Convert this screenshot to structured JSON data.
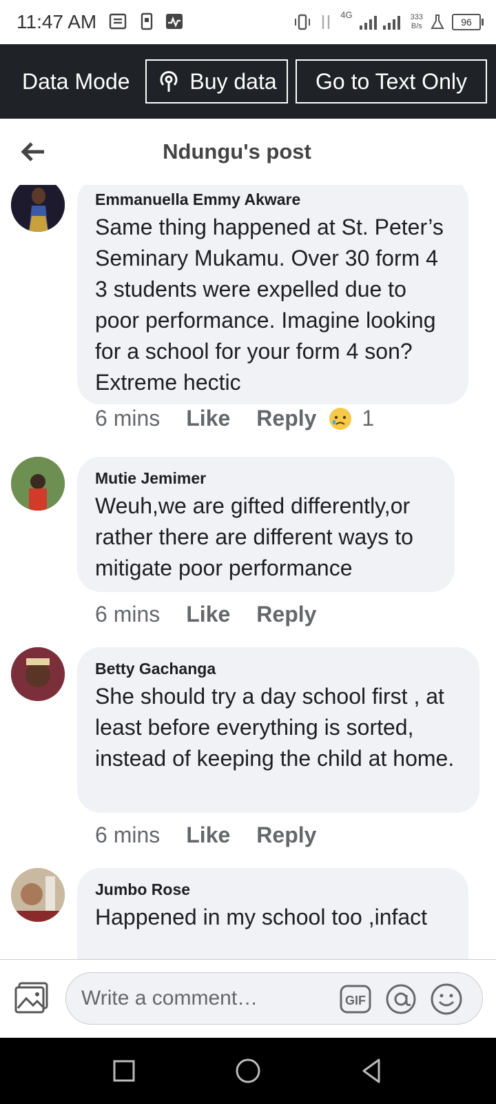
{
  "status_bar": {
    "time": "11:47 AM",
    "network": "4G",
    "speed": "333\nB/s",
    "battery": "96"
  },
  "data_bar": {
    "mode_label": "Data Mode",
    "buy_label": "Buy data",
    "text_only_label": "Go to Text Only"
  },
  "header": {
    "title": "Ndungu's post"
  },
  "comments": [
    {
      "author": "Emmanuella Emmy Akware",
      "text": "Same thing happened at St. Peter’s Seminary Mukamu. Over 30 form 4 3 students were expelled due to poor performance. Imagine looking for a school for your form 4 son? Extreme hectic",
      "time": "6 mins",
      "like": "Like",
      "reply": "Reply",
      "reaction_count": "1",
      "avatar_color": "#2a2440"
    },
    {
      "author": "Mutie Jemimer",
      "text": "Weuh,we are gifted differently,or rather there are different ways to mitigate poor performance",
      "time": "6 mins",
      "like": "Like",
      "reply": "Reply",
      "avatar_color": "#4f7a3a"
    },
    {
      "author": "Betty Gachanga",
      "text": "She should try a day school first , at least before everything is sorted, instead of keeping the child at home.",
      "time": "6 mins",
      "like": "Like",
      "reply": "Reply",
      "avatar_color": "#8a3b3b"
    },
    {
      "author": "Jumbo Rose",
      "text": "Happened in my school too ,infact",
      "avatar_color": "#b59a7a"
    }
  ],
  "composer": {
    "placeholder": "Write a comment…",
    "gif_label": "GIF"
  },
  "colors": {
    "dark_bar": "#1f2328",
    "bubble": "#f0f2f5",
    "meta_text": "#65676b"
  }
}
